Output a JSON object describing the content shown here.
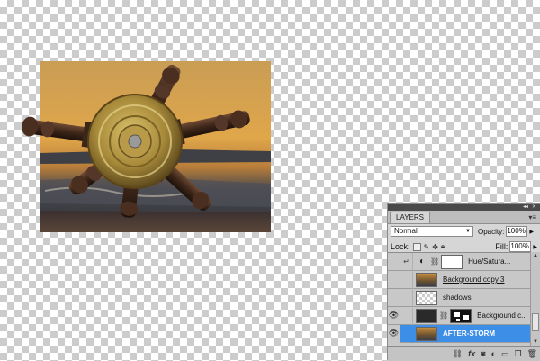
{
  "panel": {
    "title": "LAYERS",
    "blend_mode": "Normal",
    "opacity_label": "Opacity:",
    "opacity_value": "100%",
    "lock_label": "Lock:",
    "fill_label": "Fill:",
    "fill_value": "100%"
  },
  "layers": [
    {
      "name": "Hue/Satura...",
      "visible": false,
      "selected": false
    },
    {
      "name": "Background copy 3",
      "visible": false,
      "selected": false
    },
    {
      "name": "shadows",
      "visible": false,
      "selected": false
    },
    {
      "name": "Background c...",
      "visible": true,
      "selected": false
    },
    {
      "name": "AFTER-STORM",
      "visible": true,
      "selected": true
    }
  ],
  "icons": {
    "eye": "eye-icon",
    "link": "link-icon",
    "fx": "fx-icon",
    "trash": "trash-icon"
  },
  "colors": {
    "selected_layer": "#3d8ee6",
    "panel_bg": "#d6d6d6"
  }
}
